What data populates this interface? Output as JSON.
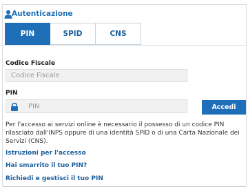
{
  "header": {
    "title": "Autenticazione",
    "icon": "user-icon"
  },
  "tabs": [
    {
      "label": "PIN",
      "active": true
    },
    {
      "label": "SPID",
      "active": false
    },
    {
      "label": "CNS",
      "active": false
    }
  ],
  "form": {
    "codice_fiscale_label": "Codice Fiscale",
    "codice_fiscale_placeholder": "Codice Fiscale",
    "pin_label": "PIN",
    "pin_placeholder": "PIN",
    "pin_icon": "lock-icon",
    "submit_label": "Accedi"
  },
  "info_text": "Per l'accesso ai servizi online è necessario il possesso di un codice PIN rilasciato dall'INPS oppure di una identità SPID o di una Carta Nazionale dei Servizi (CNS).",
  "links": [
    "Istruzioni per l'accesso",
    "Hai smarrito il tuo PIN?",
    "Richiedi e gestisci il tuo PIN"
  ],
  "colors": {
    "accent": "#1f6eb8",
    "link": "#1b5f9e",
    "title": "#2170b7"
  }
}
